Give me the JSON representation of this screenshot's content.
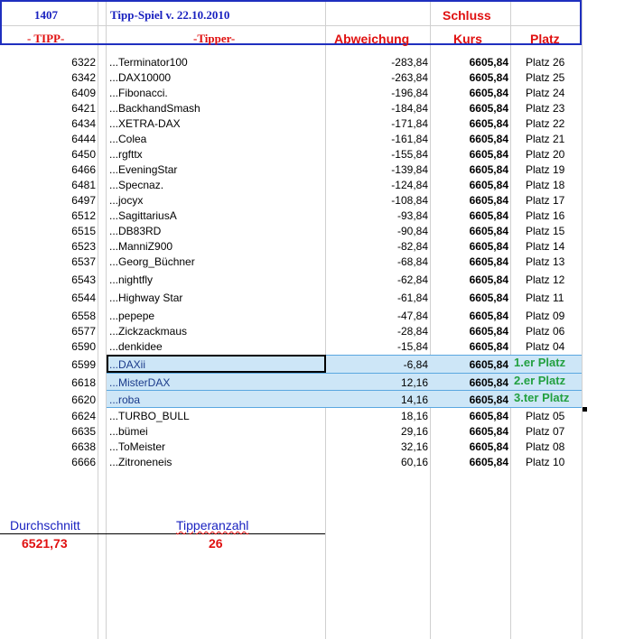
{
  "header": {
    "id_label": "1407",
    "title": "Tipp-Spiel v. 22.10.2010",
    "schluss": "Schluss",
    "tipp_col": "- TIPP-",
    "tipper_col": "-Tipper-",
    "abweichung_col": "Abweichung",
    "kurs_col": "Kurs",
    "platz_col": "Platz"
  },
  "rows": [
    {
      "tipp": "6322",
      "name": "...Terminator100",
      "abw": "-283,84",
      "kurs": "6605,84",
      "platz": "Platz 26"
    },
    {
      "tipp": "6342",
      "name": "...DAX10000",
      "abw": "-263,84",
      "kurs": "6605,84",
      "platz": "Platz 25"
    },
    {
      "tipp": "6409",
      "name": "...Fibonacci.",
      "abw": "-196,84",
      "kurs": "6605,84",
      "platz": "Platz 24"
    },
    {
      "tipp": "6421",
      "name": "...BackhandSmash",
      "abw": "-184,84",
      "kurs": "6605,84",
      "platz": "Platz 23"
    },
    {
      "tipp": "6434",
      "name": "...XETRA-DAX",
      "abw": "-171,84",
      "kurs": "6605,84",
      "platz": "Platz 22"
    },
    {
      "tipp": "6444",
      "name": "...Colea",
      "abw": "-161,84",
      "kurs": "6605,84",
      "platz": "Platz 21"
    },
    {
      "tipp": "6450",
      "name": "...rgfttx",
      "abw": "-155,84",
      "kurs": "6605,84",
      "platz": "Platz 20"
    },
    {
      "tipp": "6466",
      "name": "...EveningStar",
      "abw": "-139,84",
      "kurs": "6605,84",
      "platz": "Platz 19"
    },
    {
      "tipp": "6481",
      "name": "...Specnaz.",
      "abw": "-124,84",
      "kurs": "6605,84",
      "platz": "Platz 18"
    },
    {
      "tipp": "6497",
      "name": "...jocyx",
      "abw": "-108,84",
      "kurs": "6605,84",
      "platz": "Platz 17"
    },
    {
      "tipp": "6512",
      "name": "...SagittariusA",
      "abw": "-93,84",
      "kurs": "6605,84",
      "platz": "Platz 16"
    },
    {
      "tipp": "6515",
      "name": "...DB83RD",
      "abw": "-90,84",
      "kurs": "6605,84",
      "platz": "Platz 15"
    },
    {
      "tipp": "6523",
      "name": "...ManniZ900",
      "abw": "-82,84",
      "kurs": "6605,84",
      "platz": "Platz 14"
    },
    {
      "tipp": "6537",
      "name": "...Georg_Büchner",
      "abw": "-68,84",
      "kurs": "6605,84",
      "platz": "Platz 13"
    },
    {
      "tipp": "6543",
      "name": "...nightfly",
      "abw": "-62,84",
      "kurs": "6605,84",
      "platz": "Platz 12"
    },
    {
      "tipp": "6544",
      "name": "...Highway Star",
      "abw": "-61,84",
      "kurs": "6605,84",
      "platz": "Platz 11"
    },
    {
      "tipp": "6558",
      "name": "...pepepe",
      "abw": "-47,84",
      "kurs": "6605,84",
      "platz": "Platz 09"
    },
    {
      "tipp": "6577",
      "name": "...Zickzackmaus",
      "abw": "-28,84",
      "kurs": "6605,84",
      "platz": "Platz 06"
    },
    {
      "tipp": "6590",
      "name": "...denkidee",
      "abw": "-15,84",
      "kurs": "6605,84",
      "platz": "Platz 04"
    },
    {
      "tipp": "6599",
      "name": "...DAXii",
      "abw": "-6,84",
      "kurs": "6605,84",
      "platz": "1.er Platz"
    },
    {
      "tipp": "6618",
      "name": "...MisterDAX",
      "abw": "12,16",
      "kurs": "6605,84",
      "platz": "2.er Platz"
    },
    {
      "tipp": "6620",
      "name": "...roba",
      "abw": "14,16",
      "kurs": "6605,84",
      "platz": "3.ter Platz"
    },
    {
      "tipp": "6624",
      "name": "...TURBO_BULL",
      "abw": "18,16",
      "kurs": "6605,84",
      "platz": "Platz 05"
    },
    {
      "tipp": "6635",
      "name": "...bümei",
      "abw": "29,16",
      "kurs": "6605,84",
      "platz": "Platz 07"
    },
    {
      "tipp": "6638",
      "name": "...ToMeister",
      "abw": "32,16",
      "kurs": "6605,84",
      "platz": "Platz 08"
    },
    {
      "tipp": "6666",
      "name": "...Zitroneneis",
      "abw": "60,16",
      "kurs": "6605,84",
      "platz": "Platz 10"
    }
  ],
  "footer": {
    "durchschnitt_label": "Durchschnitt",
    "durchschnitt_value": "6521,73",
    "tipperanzahl_label": "Tipperanzahl",
    "tipperanzahl_value": "26"
  }
}
